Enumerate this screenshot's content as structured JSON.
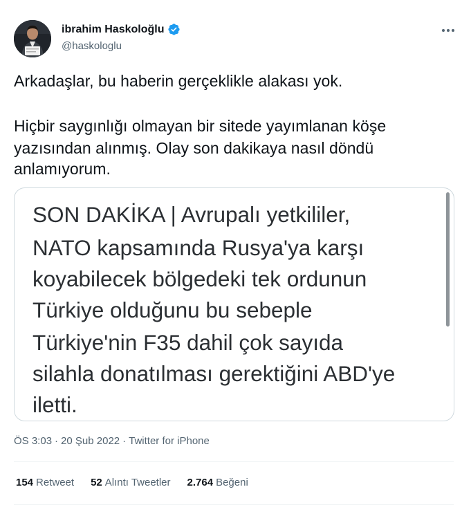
{
  "author": {
    "display_name": "ibrahim Haskoloğlu",
    "handle": "@haskologlu",
    "verified": true
  },
  "tweet": {
    "line1": "Arkadaşlar, bu haberin gerçeklikle alakası yok.",
    "line2": "Hiçbir saygınlığı olmayan bir sitede yayımlanan köşe",
    "line3": "yazısından alınmış. Olay son dakikaya nasıl döndü",
    "line4": "anlamıyorum."
  },
  "media": {
    "lines": [
      "SON DAKİKA | Avrupalı yetkililer,",
      "NATO kapsamında Rusya'ya karşı",
      "koyabilecek bölgedeki tek ordunun",
      "Türkiye olduğunu bu sebeple",
      "Türkiye'nin F35 dahil çok sayıda",
      "silahla donatılması gerektiğini ABD'ye",
      "iletti."
    ]
  },
  "meta": {
    "time": "ÖS 3:03",
    "separator1": "·",
    "date": "20 Şub 2022",
    "separator2": "·",
    "source": "Twitter for iPhone"
  },
  "stats": {
    "retweets_count": "154",
    "retweets_label": "Retweet",
    "quotes_count": "52",
    "quotes_label": "Alıntı Tweetler",
    "likes_count": "2.764",
    "likes_label": "Beğeni"
  },
  "colors": {
    "text_primary": "#0f1419",
    "text_secondary": "#536471",
    "verified_blue": "#1d9bf0",
    "border": "#cfd9de"
  },
  "icons": {
    "verified": "verified-badge-icon",
    "more": "more-options-icon"
  }
}
